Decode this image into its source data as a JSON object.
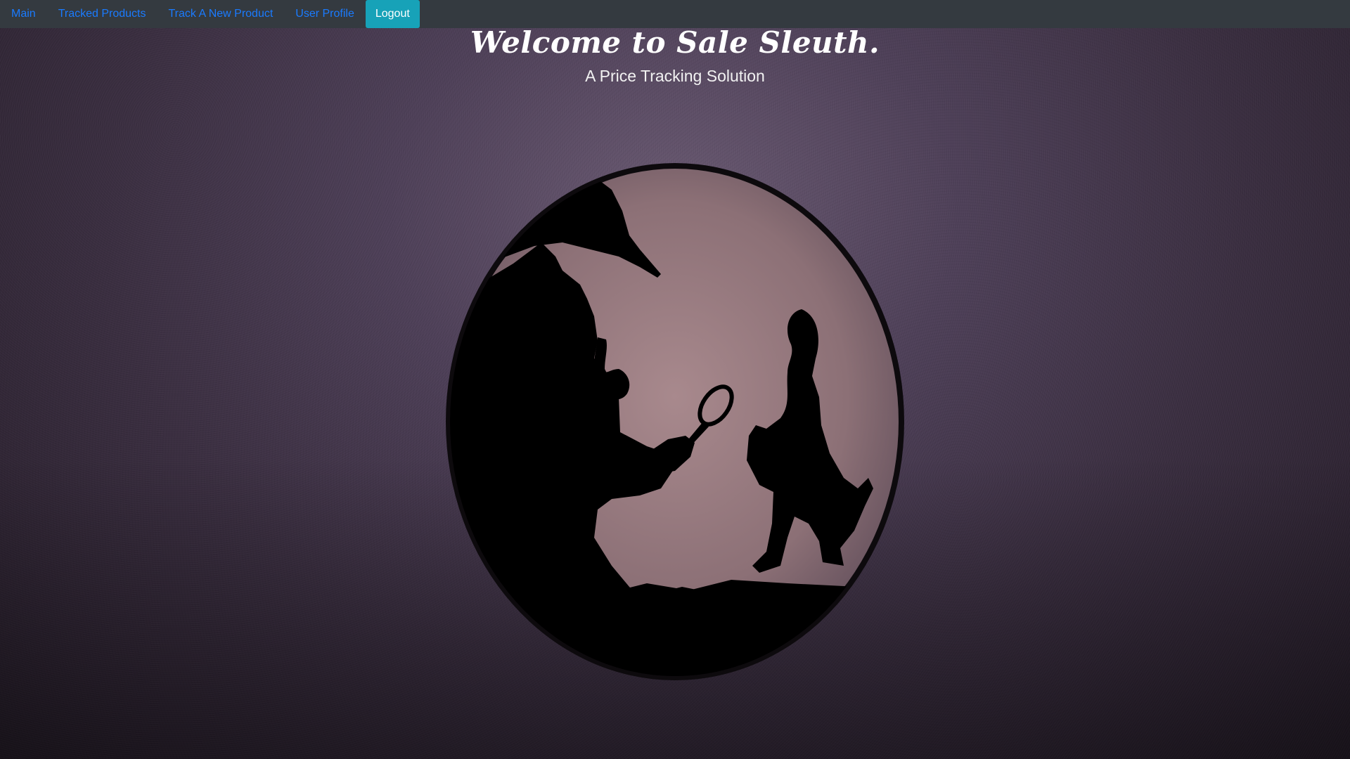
{
  "nav": {
    "items": [
      {
        "label": "Main"
      },
      {
        "label": "Tracked Products"
      },
      {
        "label": "Track A New Product"
      },
      {
        "label": "User Profile"
      }
    ],
    "logout_label": "Logout"
  },
  "hero": {
    "title": "Welcome to Sale Sleuth.",
    "subtitle": "A Price Tracking Solution"
  },
  "illustration": {
    "name": "detective-silhouette-icon"
  },
  "colors": {
    "navbar_bg": "#343a40",
    "link": "#1a7bff",
    "logout_bg": "#17a2b8",
    "medallion_bg": "#9c7f84"
  }
}
